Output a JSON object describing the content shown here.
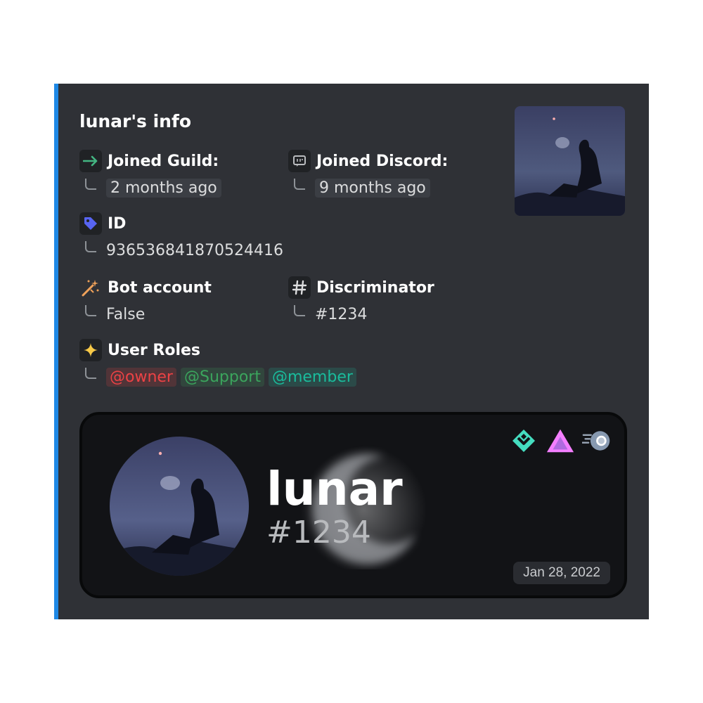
{
  "embed": {
    "accent_color": "#1e88e5",
    "title": "lunar's info",
    "thumbnail": "user-photo-silhouette-night-sky",
    "fields": {
      "joined_guild": {
        "name": "Joined Guild:",
        "value": "2 months ago",
        "icon": "arrow-right-icon"
      },
      "joined_discord": {
        "name": "Joined Discord:",
        "value": "9 months ago",
        "icon": "discord-chat-icon"
      },
      "id": {
        "name": "ID",
        "value": "936536841870524416",
        "icon": "tag-icon"
      },
      "bot_account": {
        "name": "Bot account",
        "value": "False",
        "icon": "magic-wand-icon"
      },
      "discriminator": {
        "name": "Discriminator",
        "value": "#1234",
        "icon": "hash-icon"
      },
      "user_roles": {
        "name": "User Roles",
        "icon": "sparkle-icon",
        "roles": [
          {
            "label": "@owner",
            "color": "#ed4245"
          },
          {
            "label": "@Support",
            "color": "#3ba55d"
          },
          {
            "label": "@member",
            "color": "#1abc9c"
          }
        ]
      }
    }
  },
  "card": {
    "username": "lunar",
    "discriminator": "#1234",
    "date": "Jan 28, 2022",
    "badges": [
      "hypesquad-balance-icon",
      "early-supporter-triangle-icon",
      "nitro-boost-icon"
    ]
  }
}
